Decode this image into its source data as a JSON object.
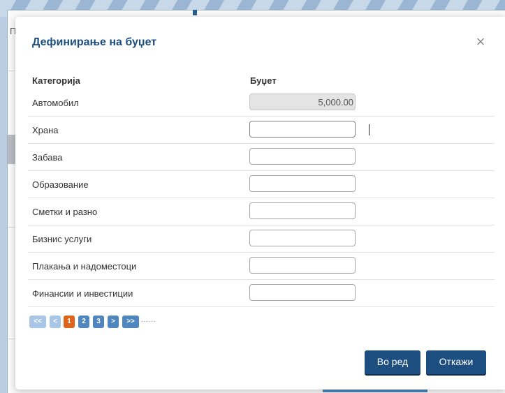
{
  "background": {
    "glyph": "П"
  },
  "dialog": {
    "title": "Дефинирање на буџет",
    "close_icon": "close-icon",
    "headers": {
      "category": "Категорија",
      "budget": "Буџет"
    },
    "rows": [
      {
        "label": "Автомобил",
        "value": "5,000.00",
        "disabled": true
      },
      {
        "label": "Храна",
        "value": "",
        "focused": true
      },
      {
        "label": "Забава",
        "value": ""
      },
      {
        "label": "Образование",
        "value": ""
      },
      {
        "label": "Сметки и разно",
        "value": ""
      },
      {
        "label": "Бизнис услуги",
        "value": ""
      },
      {
        "label": "Плакања и надоместоци",
        "value": ""
      },
      {
        "label": "Финансии и инвестиции",
        "value": ""
      }
    ],
    "pagination": {
      "first": "<<",
      "prev": "<",
      "pages": [
        "1",
        "2",
        "3"
      ],
      "current": "1",
      "next": ">",
      "last": ">>",
      "dots": "······"
    },
    "buttons": {
      "ok": "Во ред",
      "cancel": "Откажи"
    },
    "colors": {
      "title": "#1d4e80",
      "button": "#1d4e80",
      "page_current": "#e0631b",
      "page": "#4e86bd"
    }
  }
}
